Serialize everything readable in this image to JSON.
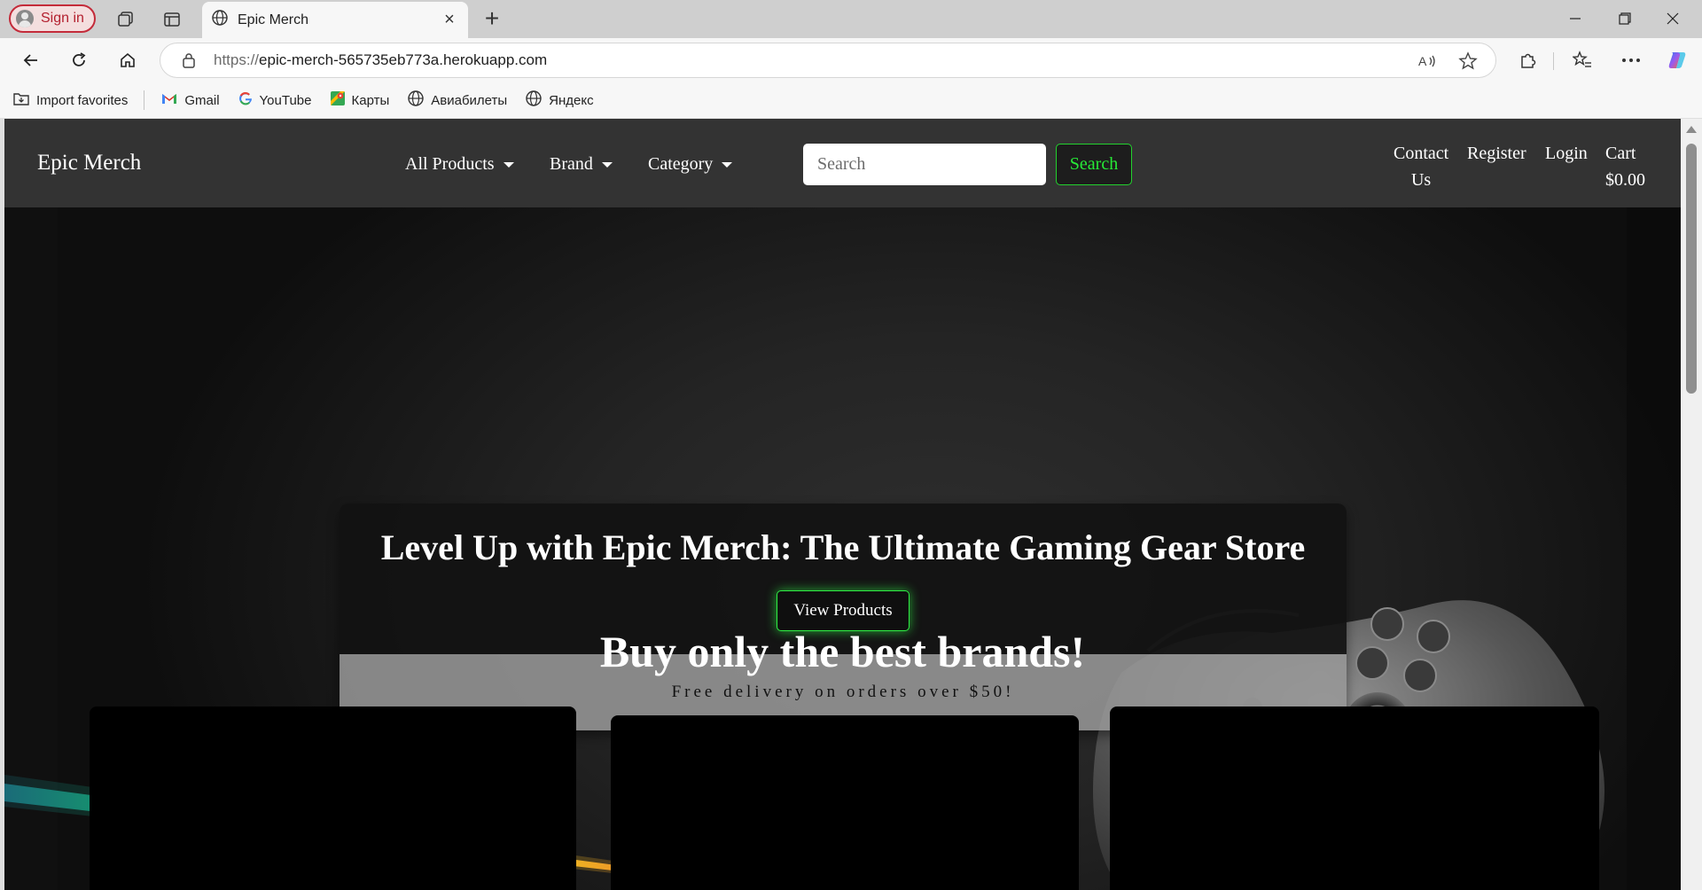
{
  "browser": {
    "sign_in_label": "Sign in",
    "tab_title": "Epic Merch",
    "url_protocol": "https://",
    "url_host": "epic-merch-565735eb773a.herokuapp.com",
    "bookmarks": [
      {
        "label": "Import favorites",
        "icon": "import-icon"
      },
      {
        "label": "Gmail",
        "icon": "gmail-icon"
      },
      {
        "label": "YouTube",
        "icon": "google-icon"
      },
      {
        "label": "Карты",
        "icon": "maps-icon"
      },
      {
        "label": "Авиабилеты",
        "icon": "globe-icon"
      },
      {
        "label": "Яндекс",
        "icon": "globe-icon"
      }
    ]
  },
  "site": {
    "brand": "Epic Merch",
    "nav": {
      "all_products": "All Products",
      "brand": "Brand",
      "category": "Category",
      "search_placeholder": "Search",
      "search_button": "Search",
      "contact_line1": "Contact",
      "contact_line2": "Us",
      "register": "Register",
      "login": "Login",
      "cart_label": "Cart",
      "cart_total": "$0.00"
    },
    "hero": {
      "title": "Level Up with Epic Merch: The Ultimate Gaming Gear Store",
      "cta": "View Products",
      "delivery_note": "Free delivery on orders over $50!"
    },
    "brands_heading": "Buy only the best brands!"
  },
  "colors": {
    "accent_green": "#27ea37",
    "nav_bg": "#333333",
    "signin_red": "#c42b3a"
  }
}
